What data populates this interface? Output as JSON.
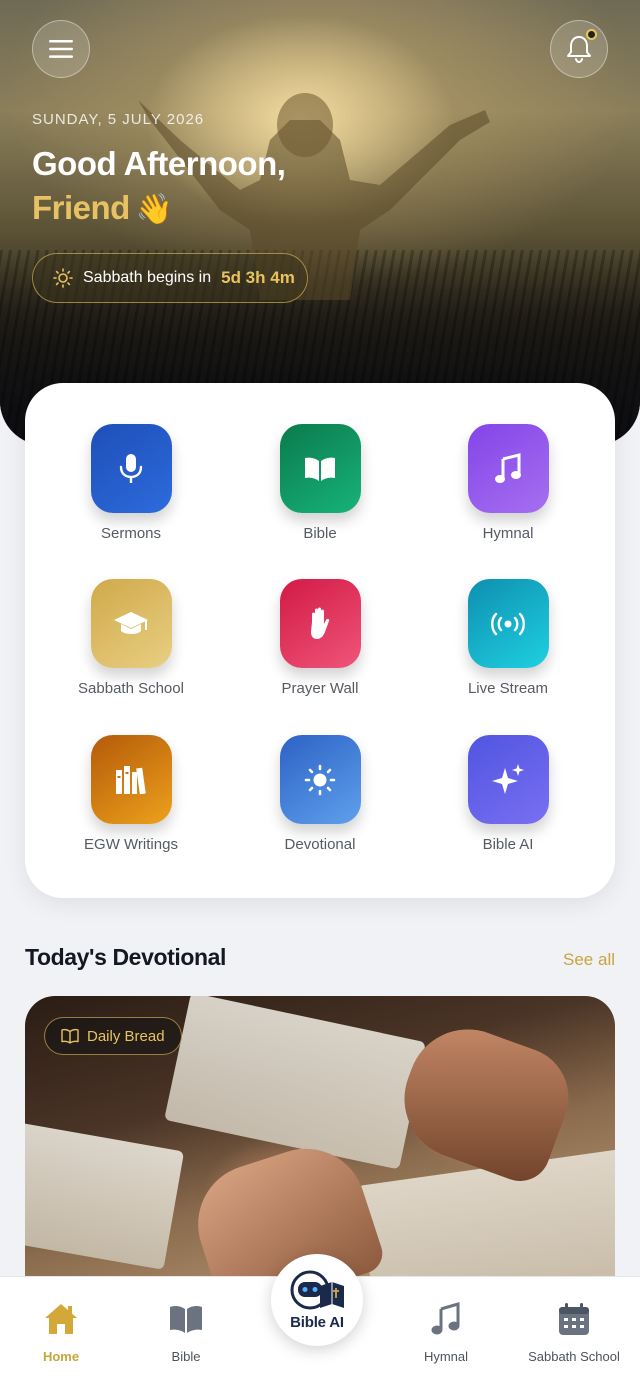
{
  "header": {
    "date": "SUNDAY, 5 JULY 2026",
    "greeting": "Good Afternoon,",
    "name": "Friend",
    "wave_emoji": "👋",
    "sabbath_label": "Sabbath begins in",
    "sabbath_countdown": "5d 3h 4m",
    "icons": {
      "menu": "hamburger-menu-icon",
      "notifications": "bell-icon",
      "sabbath": "sun-icon"
    }
  },
  "grid": [
    {
      "label": "Sermons",
      "icon": "microphone-icon",
      "color_from": "#1e4fb8",
      "color_to": "#2d6bdc"
    },
    {
      "label": "Bible",
      "icon": "open-book-icon",
      "color_from": "#0b7a4c",
      "color_to": "#17b37a"
    },
    {
      "label": "Hymnal",
      "icon": "music-note-icon",
      "color_from": "#8345e8",
      "color_to": "#a66ff0"
    },
    {
      "label": "Sabbath School",
      "icon": "graduation-cap-icon",
      "color_from": "#d0a94b",
      "color_to": "#e8cf82"
    },
    {
      "label": "Prayer Wall",
      "icon": "raised-hand-icon",
      "color_from": "#d11a45",
      "color_to": "#f0557a"
    },
    {
      "label": "Live Stream",
      "icon": "broadcast-icon",
      "color_from": "#0e8fb0",
      "color_to": "#1fd0e0"
    },
    {
      "label": "EGW Writings",
      "icon": "books-icon",
      "color_from": "#b35a0a",
      "color_to": "#eda11c"
    },
    {
      "label": "Devotional",
      "icon": "sun-icon",
      "color_from": "#2d62c5",
      "color_to": "#5fa0ec"
    },
    {
      "label": "Bible AI",
      "icon": "sparkles-icon",
      "color_from": "#4f55e0",
      "color_to": "#7a6ff2"
    }
  ],
  "devotional": {
    "section_title": "Today's Devotional",
    "see_all": "See all",
    "badge": "Daily Bread"
  },
  "bottom_nav": {
    "items": [
      {
        "label": "Home",
        "icon": "home-icon",
        "active": true
      },
      {
        "label": "Bible",
        "icon": "book-icon",
        "active": false
      },
      {
        "label": "Hymnal",
        "icon": "music-note-icon",
        "active": false
      },
      {
        "label": "Sabbath School",
        "icon": "calendar-icon",
        "active": false
      }
    ],
    "center": {
      "label": "Bible AI",
      "icon": "robot-bible-logo-icon"
    }
  },
  "colors": {
    "accent": "#c9a43c",
    "gold": "#e8c262",
    "text_dark": "#141821"
  }
}
